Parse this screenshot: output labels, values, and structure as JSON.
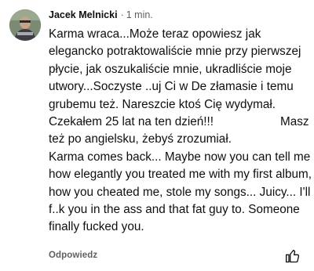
{
  "comment": {
    "author": "Jacek Melnicki",
    "separator": "·",
    "time": "1 min.",
    "text_pl": "Karma wraca...Może teraz opowiesz jak elegancko potraktowaliście mnie przy pierwszej płycie, jak oszukaliście mnie, ukradliście moje utwory...Soczyste ..uj Ci w De złamasie i temu grubemu też. Nareszcie ktoś Cię wydymał. Czekałem 25 lat na ten dzień!!!                    Masz też po angielsku, żebyś zrozumiał.",
    "text_en": "Karma comes back... Maybe now you can tell me how elegantly you treated me with my first album, how you cheated me, stole my songs... Juicy... I'll f..k you in the ass and that fat guy to. Someone finally fucked you.",
    "reply_label": "Odpowiedz",
    "avatar_icon": "user-avatar-photo",
    "like_icon": "thumb-up-icon"
  }
}
